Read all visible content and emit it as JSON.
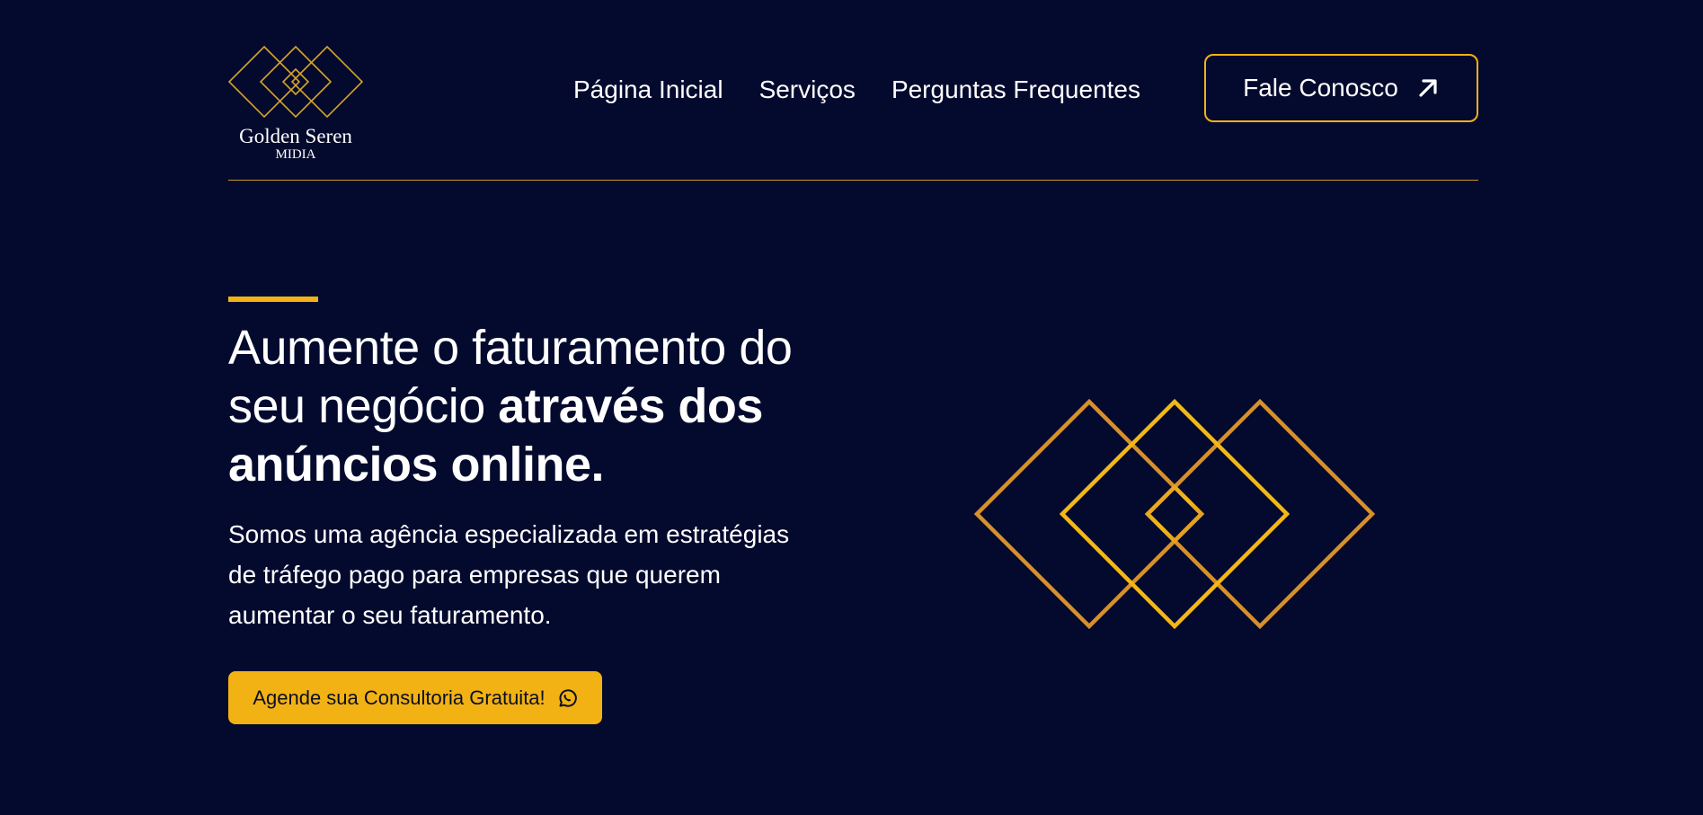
{
  "brand": {
    "name": "Golden Seren",
    "subtitle": "MIDIA",
    "logo_icon": "diamonds-logo-icon"
  },
  "nav": {
    "items": [
      {
        "label": "Página Inicial"
      },
      {
        "label": "Serviços"
      },
      {
        "label": "Perguntas Frequentes"
      }
    ],
    "contact_button": {
      "label": "Fale Conosco",
      "icon": "arrow-up-right-icon"
    }
  },
  "hero": {
    "title_regular": "Aumente o faturamento do seu negócio",
    "title_bold": "através dos anúncios online.",
    "description": "Somos uma agência especializada em estratégias de tráfego pago para empresas que querem aumentar o seu faturamento.",
    "cta": {
      "label": "Agende sua Consultoria Gratuita!",
      "icon": "whatsapp-icon"
    },
    "graphic_icon": "golden-diamonds-graphic"
  },
  "colors": {
    "background": "#040a2e",
    "accent": "#f2b214",
    "accent_dark": "#d08f28",
    "text": "#ffffff",
    "cta_text": "#0a0f24"
  }
}
